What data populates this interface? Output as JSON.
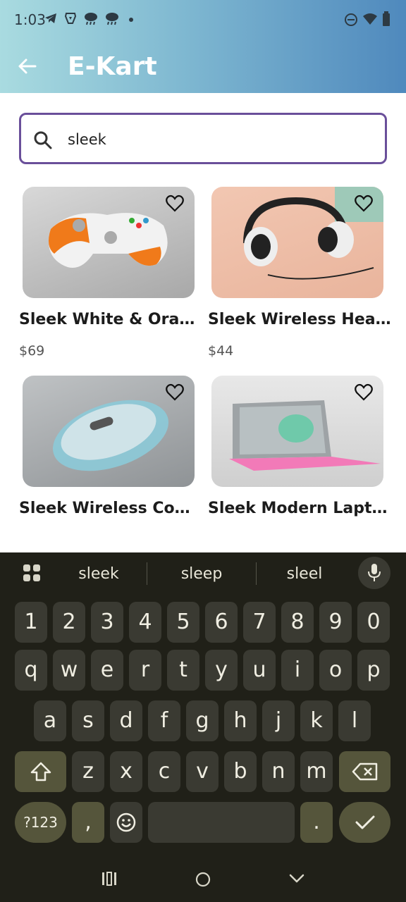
{
  "status_bar": {
    "time": "1:03"
  },
  "app_bar": {
    "title": "E-Kart"
  },
  "search": {
    "value": "sleek"
  },
  "products": [
    {
      "name": "Sleek White & Orange...",
      "price": "$69"
    },
    {
      "name": "Sleek Wireless Head...",
      "price": "$44"
    },
    {
      "name": "Sleek Wireless Comp...",
      "price": ""
    },
    {
      "name": "Sleek Modern Laptop...",
      "price": ""
    }
  ],
  "keyboard": {
    "suggestions": [
      "sleek",
      "sleep",
      "sleel"
    ],
    "row_numbers": [
      "1",
      "2",
      "3",
      "4",
      "5",
      "6",
      "7",
      "8",
      "9",
      "0"
    ],
    "row1": [
      "q",
      "w",
      "e",
      "r",
      "t",
      "y",
      "u",
      "i",
      "o",
      "p"
    ],
    "row2": [
      "a",
      "s",
      "d",
      "f",
      "g",
      "h",
      "j",
      "k",
      "l"
    ],
    "row3": [
      "z",
      "x",
      "c",
      "v",
      "b",
      "n",
      "m"
    ],
    "symbols_label": "?123",
    "comma": ",",
    "period": "."
  },
  "colors": {
    "accent": "#6a4f9a",
    "header_start": "#a9dbe0",
    "header_end": "#4f89bd",
    "keyboard_bg": "#202018"
  }
}
